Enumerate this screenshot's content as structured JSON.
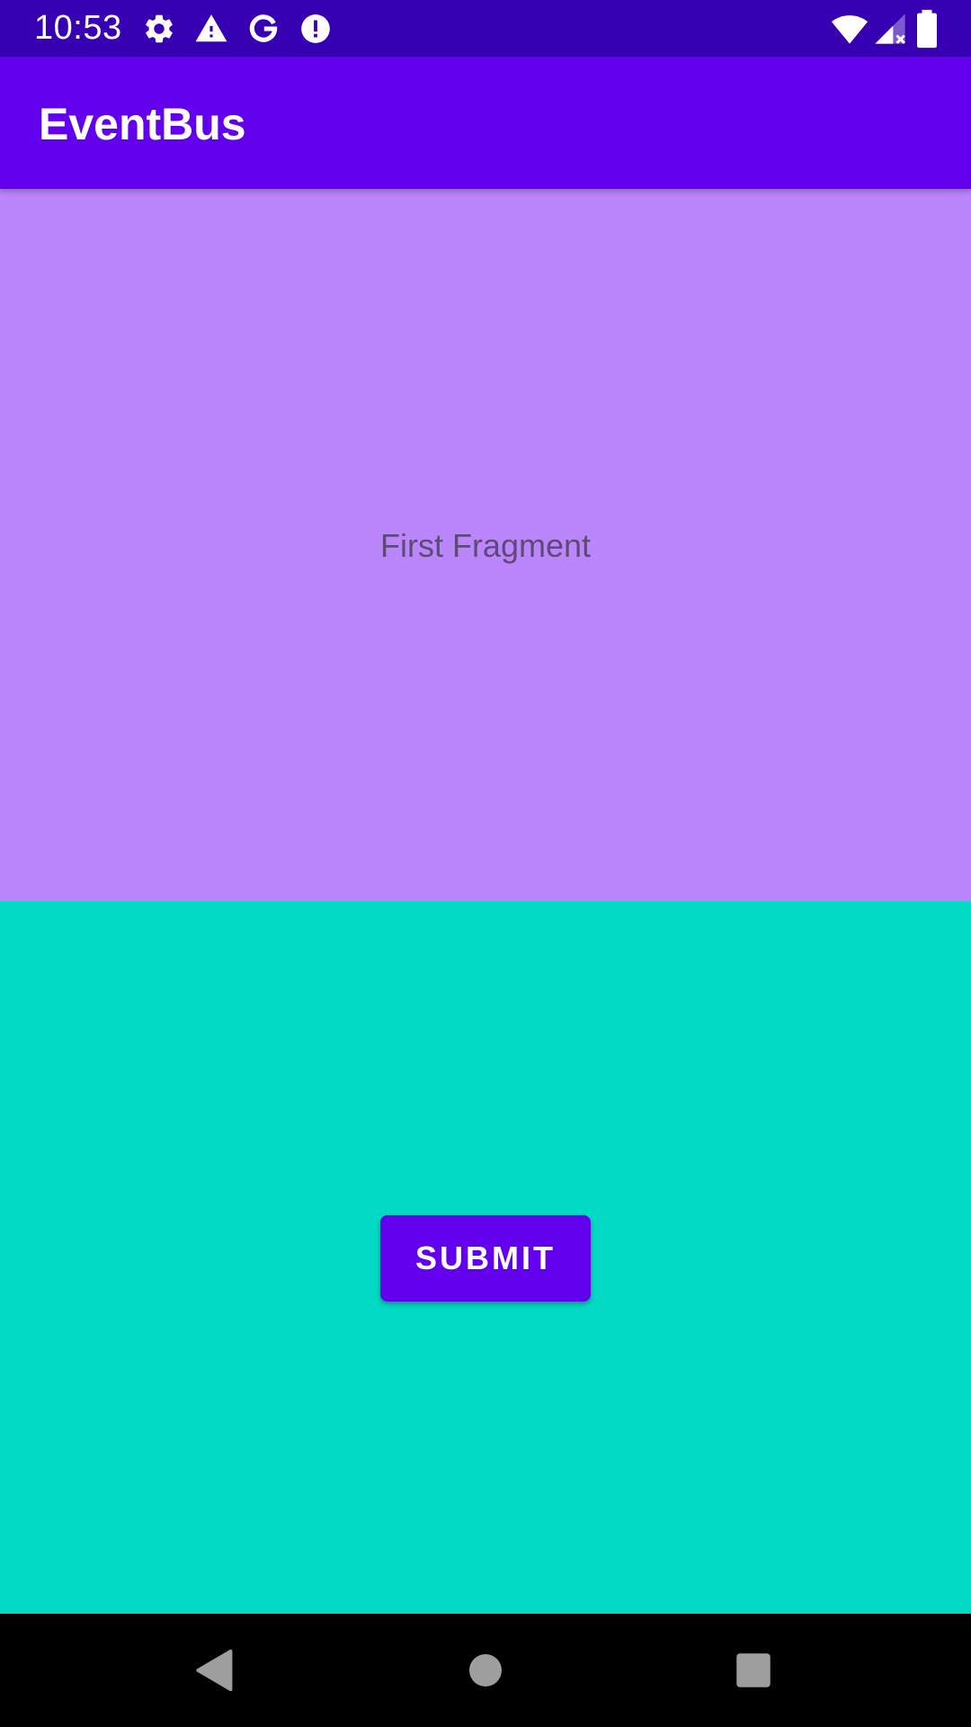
{
  "status_bar": {
    "time": "10:53",
    "left_icons": [
      "gear-icon",
      "warning-icon",
      "google-icon",
      "alert-circle-icon"
    ],
    "right_icons": [
      "wifi-icon",
      "cell-signal-icon",
      "battery-icon"
    ],
    "background": "#3700b3"
  },
  "app_bar": {
    "title": "EventBus",
    "background": "#6200ee"
  },
  "first_fragment": {
    "text": "First Fragment",
    "background": "#bb86fc"
  },
  "second_fragment": {
    "button_label": "SUBMIT",
    "background": "#03dac5",
    "button_color": "#6200ee"
  },
  "nav_bar": {
    "buttons": [
      "back-icon",
      "home-icon",
      "recents-icon"
    ]
  }
}
